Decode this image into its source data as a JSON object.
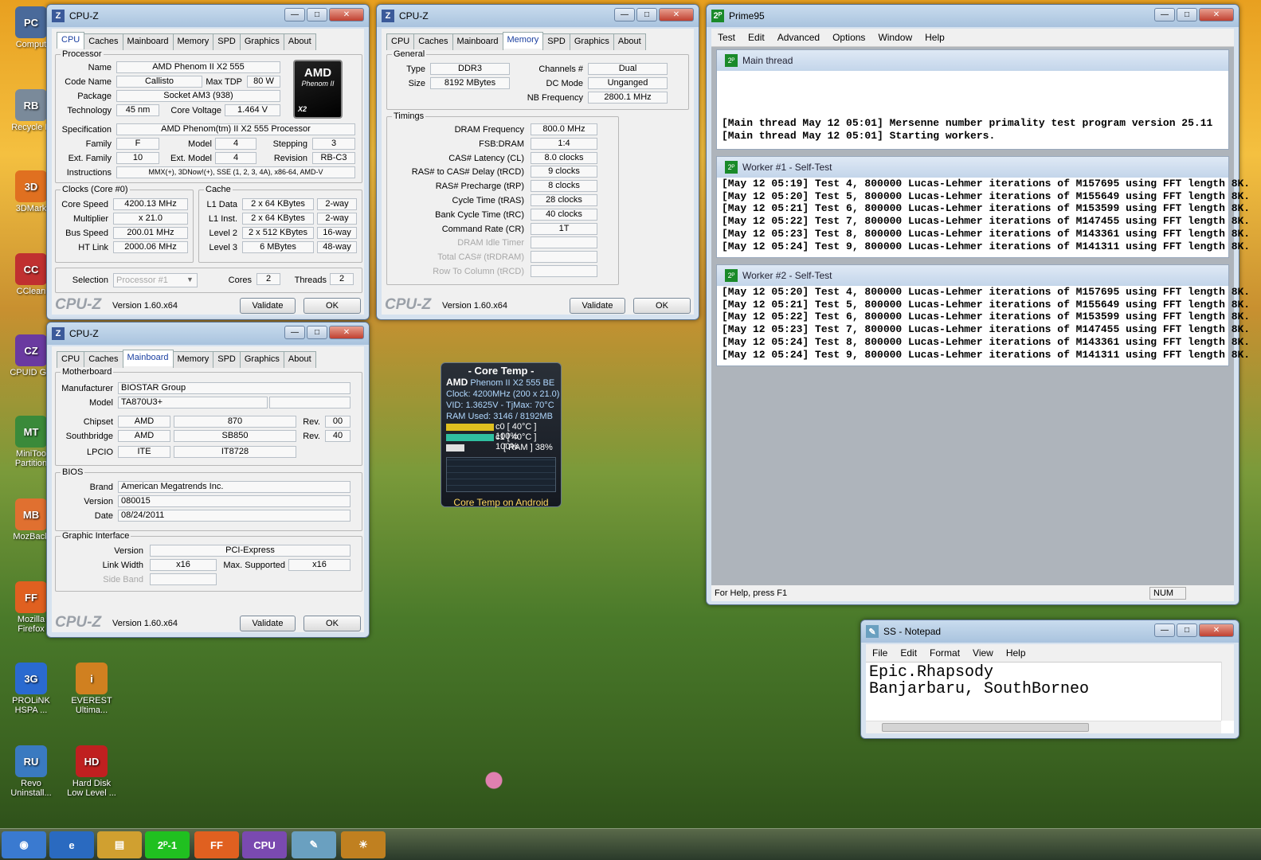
{
  "desktop": {
    "icons": [
      {
        "label": "Comput",
        "color": "#4a6a9a",
        "glyph": "PC"
      },
      {
        "label": "Recycle B",
        "color": "#7a8a9a",
        "glyph": "RB"
      },
      {
        "label": "3DMark",
        "color": "#e07020",
        "glyph": "3D"
      },
      {
        "label": "CClean",
        "color": "#c03030",
        "glyph": "CC"
      },
      {
        "label": "CPUID GP",
        "color": "#6a3aa0",
        "glyph": "CZ"
      },
      {
        "label": "MiniToo Partition",
        "color": "#3a8a3a",
        "glyph": "MT"
      },
      {
        "label": "MozBack",
        "color": "#e07030",
        "glyph": "MB"
      },
      {
        "label": "Mozilla Firefox",
        "color": "#e06020",
        "glyph": "FF"
      },
      {
        "label": "PROLiNK HSPA ...",
        "color": "#2a6ad0",
        "glyph": "3G"
      },
      {
        "label": "EVEREST Ultima...",
        "color": "#d08020",
        "glyph": "i"
      },
      {
        "label": "Revo Uninstall...",
        "color": "#3a7ac0",
        "glyph": "RU"
      },
      {
        "label": "Hard Disk Low Level ...",
        "color": "#c02020",
        "glyph": "HD"
      }
    ]
  },
  "cpuz1": {
    "title": "CPU-Z",
    "tabs": [
      "CPU",
      "Caches",
      "Mainboard",
      "Memory",
      "SPD",
      "Graphics",
      "About"
    ],
    "processor_group": "Processor",
    "name_label": "Name",
    "name": "AMD Phenom II X2 555",
    "codename_label": "Code Name",
    "codename": "Callisto",
    "maxtdp_label": "Max TDP",
    "maxtdp": "80 W",
    "package_label": "Package",
    "package": "Socket AM3 (938)",
    "tech_label": "Technology",
    "tech": "45 nm",
    "voltage_label": "Core Voltage",
    "voltage": "1.464 V",
    "spec_label": "Specification",
    "spec": "AMD Phenom(tm) II X2 555 Processor",
    "family_label": "Family",
    "family": "F",
    "model_label": "Model",
    "model": "4",
    "stepping_label": "Stepping",
    "stepping": "3",
    "extfam_label": "Ext. Family",
    "extfam": "10",
    "extmodel_label": "Ext. Model",
    "extmodel": "4",
    "revision_label": "Revision",
    "revision": "RB-C3",
    "instr_label": "Instructions",
    "instr": "MMX(+), 3DNow!(+), SSE (1, 2, 3, 4A), x86-64, AMD-V",
    "logo_top": "AMD",
    "logo_mid": "Phenom II",
    "logo_bot": "X2",
    "clocks_group": "Clocks (Core #0)",
    "corespeed_label": "Core Speed",
    "corespeed": "4200.13 MHz",
    "mult_label": "Multiplier",
    "mult": "x 21.0",
    "bus_label": "Bus Speed",
    "bus": "200.01 MHz",
    "ht_label": "HT Link",
    "ht": "2000.06 MHz",
    "cache_group": "Cache",
    "l1d_label": "L1 Data",
    "l1d": "2 x 64 KBytes",
    "l1d_way": "2-way",
    "l1i_label": "L1 Inst.",
    "l1i": "2 x 64 KBytes",
    "l1i_way": "2-way",
    "l2_label": "Level 2",
    "l2": "2 x 512 KBytes",
    "l2_way": "16-way",
    "l3_label": "Level 3",
    "l3": "6 MBytes",
    "l3_way": "48-way",
    "selection_label": "Selection",
    "selection": "Processor #1",
    "cores_label": "Cores",
    "cores": "2",
    "threads_label": "Threads",
    "threads": "2",
    "brand": "CPU-Z",
    "version": "Version 1.60.x64",
    "validate": "Validate",
    "ok": "OK"
  },
  "cpuz2": {
    "title": "CPU-Z",
    "tabs": [
      "CPU",
      "Caches",
      "Mainboard",
      "Memory",
      "SPD",
      "Graphics",
      "About"
    ],
    "general_group": "General",
    "type_label": "Type",
    "type": "DDR3",
    "channels_label": "Channels #",
    "channels": "Dual",
    "size_label": "Size",
    "size": "8192 MBytes",
    "dcmode_label": "DC Mode",
    "dcmode": "Unganged",
    "nbfreq_label": "NB Frequency",
    "nbfreq": "2800.1 MHz",
    "timings_group": "Timings",
    "timings": [
      {
        "label": "DRAM Frequency",
        "value": "800.0 MHz",
        "gray": false
      },
      {
        "label": "FSB:DRAM",
        "value": "1:4",
        "gray": false
      },
      {
        "label": "CAS# Latency (CL)",
        "value": "8.0 clocks",
        "gray": false
      },
      {
        "label": "RAS# to CAS# Delay (tRCD)",
        "value": "9 clocks",
        "gray": false
      },
      {
        "label": "RAS# Precharge (tRP)",
        "value": "8 clocks",
        "gray": false
      },
      {
        "label": "Cycle Time (tRAS)",
        "value": "28 clocks",
        "gray": false
      },
      {
        "label": "Bank Cycle Time (tRC)",
        "value": "40 clocks",
        "gray": false
      },
      {
        "label": "Command Rate (CR)",
        "value": "1T",
        "gray": false
      },
      {
        "label": "DRAM Idle Timer",
        "value": "",
        "gray": true
      },
      {
        "label": "Total CAS# (tRDRAM)",
        "value": "",
        "gray": true
      },
      {
        "label": "Row To Column (tRCD)",
        "value": "",
        "gray": true
      }
    ],
    "brand": "CPU-Z",
    "version": "Version 1.60.x64",
    "validate": "Validate",
    "ok": "OK"
  },
  "cpuz3": {
    "title": "CPU-Z",
    "tabs": [
      "CPU",
      "Caches",
      "Mainboard",
      "Memory",
      "SPD",
      "Graphics",
      "About"
    ],
    "mb_group": "Motherboard",
    "manu_label": "Manufacturer",
    "manu": "BIOSTAR Group",
    "model_label": "Model",
    "model": "TA870U3+",
    "chipset_label": "Chipset",
    "chipset_v": "AMD",
    "chipset_m": "870",
    "rev_label": "Rev.",
    "chipset_rev": "00",
    "sb_label": "Southbridge",
    "sb_v": "AMD",
    "sb_m": "SB850",
    "sb_rev": "40",
    "lpcio_label": "LPCIO",
    "lpcio_v": "ITE",
    "lpcio_m": "IT8728",
    "bios_group": "BIOS",
    "brand_label": "Brand",
    "bios_brand": "American Megatrends Inc.",
    "version_label": "Version",
    "bios_version": "080015",
    "date_label": "Date",
    "bios_date": "08/24/2011",
    "gi_group": "Graphic Interface",
    "gi_version_label": "Version",
    "gi_version": "PCI-Express",
    "linkwidth_label": "Link Width",
    "linkwidth": "x16",
    "maxsup_label": "Max. Supported",
    "maxsup": "x16",
    "sideband_label": "Side Band",
    "brand": "CPU-Z",
    "version": "Version 1.60.x64",
    "validate": "Validate",
    "ok": "OK"
  },
  "prime95": {
    "title": "Prime95",
    "menu": [
      "Test",
      "Edit",
      "Advanced",
      "Options",
      "Window",
      "Help"
    ],
    "main_title": "Main thread",
    "main_log": [
      "[Main thread May 12 05:01] Mersenne number primality test program version 25.11",
      "[Main thread May 12 05:01] Starting workers."
    ],
    "w1_title": "Worker #1 - Self-Test",
    "w1_log": [
      "[May 12 05:19] Test 4, 800000 Lucas-Lehmer iterations of M157695 using FFT length 8K.",
      "[May 12 05:20] Test 5, 800000 Lucas-Lehmer iterations of M155649 using FFT length 8K.",
      "[May 12 05:21] Test 6, 800000 Lucas-Lehmer iterations of M153599 using FFT length 8K.",
      "[May 12 05:22] Test 7, 800000 Lucas-Lehmer iterations of M147455 using FFT length 8K.",
      "[May 12 05:23] Test 8, 800000 Lucas-Lehmer iterations of M143361 using FFT length 8K.",
      "[May 12 05:24] Test 9, 800000 Lucas-Lehmer iterations of M141311 using FFT length 8K."
    ],
    "w2_title": "Worker #2 - Self-Test",
    "w2_log": [
      "[May 12 05:20] Test 4, 800000 Lucas-Lehmer iterations of M157695 using FFT length 8K.",
      "[May 12 05:21] Test 5, 800000 Lucas-Lehmer iterations of M155649 using FFT length 8K.",
      "[May 12 05:22] Test 6, 800000 Lucas-Lehmer iterations of M153599 using FFT length 8K.",
      "[May 12 05:23] Test 7, 800000 Lucas-Lehmer iterations of M147455 using FFT length 8K.",
      "[May 12 05:24] Test 8, 800000 Lucas-Lehmer iterations of M143361 using FFT length 8K.",
      "[May 12 05:24] Test 9, 800000 Lucas-Lehmer iterations of M141311 using FFT length 8K."
    ],
    "status": "For Help, press F1",
    "num": "NUM"
  },
  "coretemp": {
    "title": "- Core Temp -",
    "brand": "AMD",
    "model": "Phenom II X2 555 BE",
    "clock": "Clock: 4200MHz (200 x 21.0)",
    "vid": "VID: 1.3625V - TjMax: 70°C",
    "ram": "RAM Used: 3146 / 8192MB",
    "c0": "c0 [ 40°C ] 100%",
    "c0_load": 1.0,
    "c1": "c1 [ 40°C ] 100%",
    "c1_load": 1.0,
    "ramline": "[ RAM ]  38%",
    "ram_load": 0.38,
    "footer": "Core Temp on Android"
  },
  "notepad": {
    "title": "SS - Notepad",
    "menu": [
      "File",
      "Edit",
      "Format",
      "View",
      "Help"
    ],
    "lines": [
      "Epic.Rhapsody",
      "Banjarbaru, SouthBorneo"
    ]
  },
  "taskbar": {
    "items": [
      {
        "name": "start-button",
        "glyph": "◉",
        "color": "#3a7ad0"
      },
      {
        "name": "ie-button",
        "glyph": "e",
        "color": "#2a6ac0"
      },
      {
        "name": "explorer-button",
        "glyph": "▤",
        "color": "#d0a030"
      },
      {
        "name": "prime95-button",
        "glyph": "2ᴾ-1",
        "color": "#20c020"
      },
      {
        "name": "firefox-button",
        "glyph": "FF",
        "color": "#e06020"
      },
      {
        "name": "cpuz-button",
        "glyph": "CPU",
        "color": "#7a4ab0"
      },
      {
        "name": "notepad-button",
        "glyph": "✎",
        "color": "#6aa0c0"
      },
      {
        "name": "coretemp-button",
        "glyph": "☀",
        "color": "#c08020"
      }
    ]
  }
}
